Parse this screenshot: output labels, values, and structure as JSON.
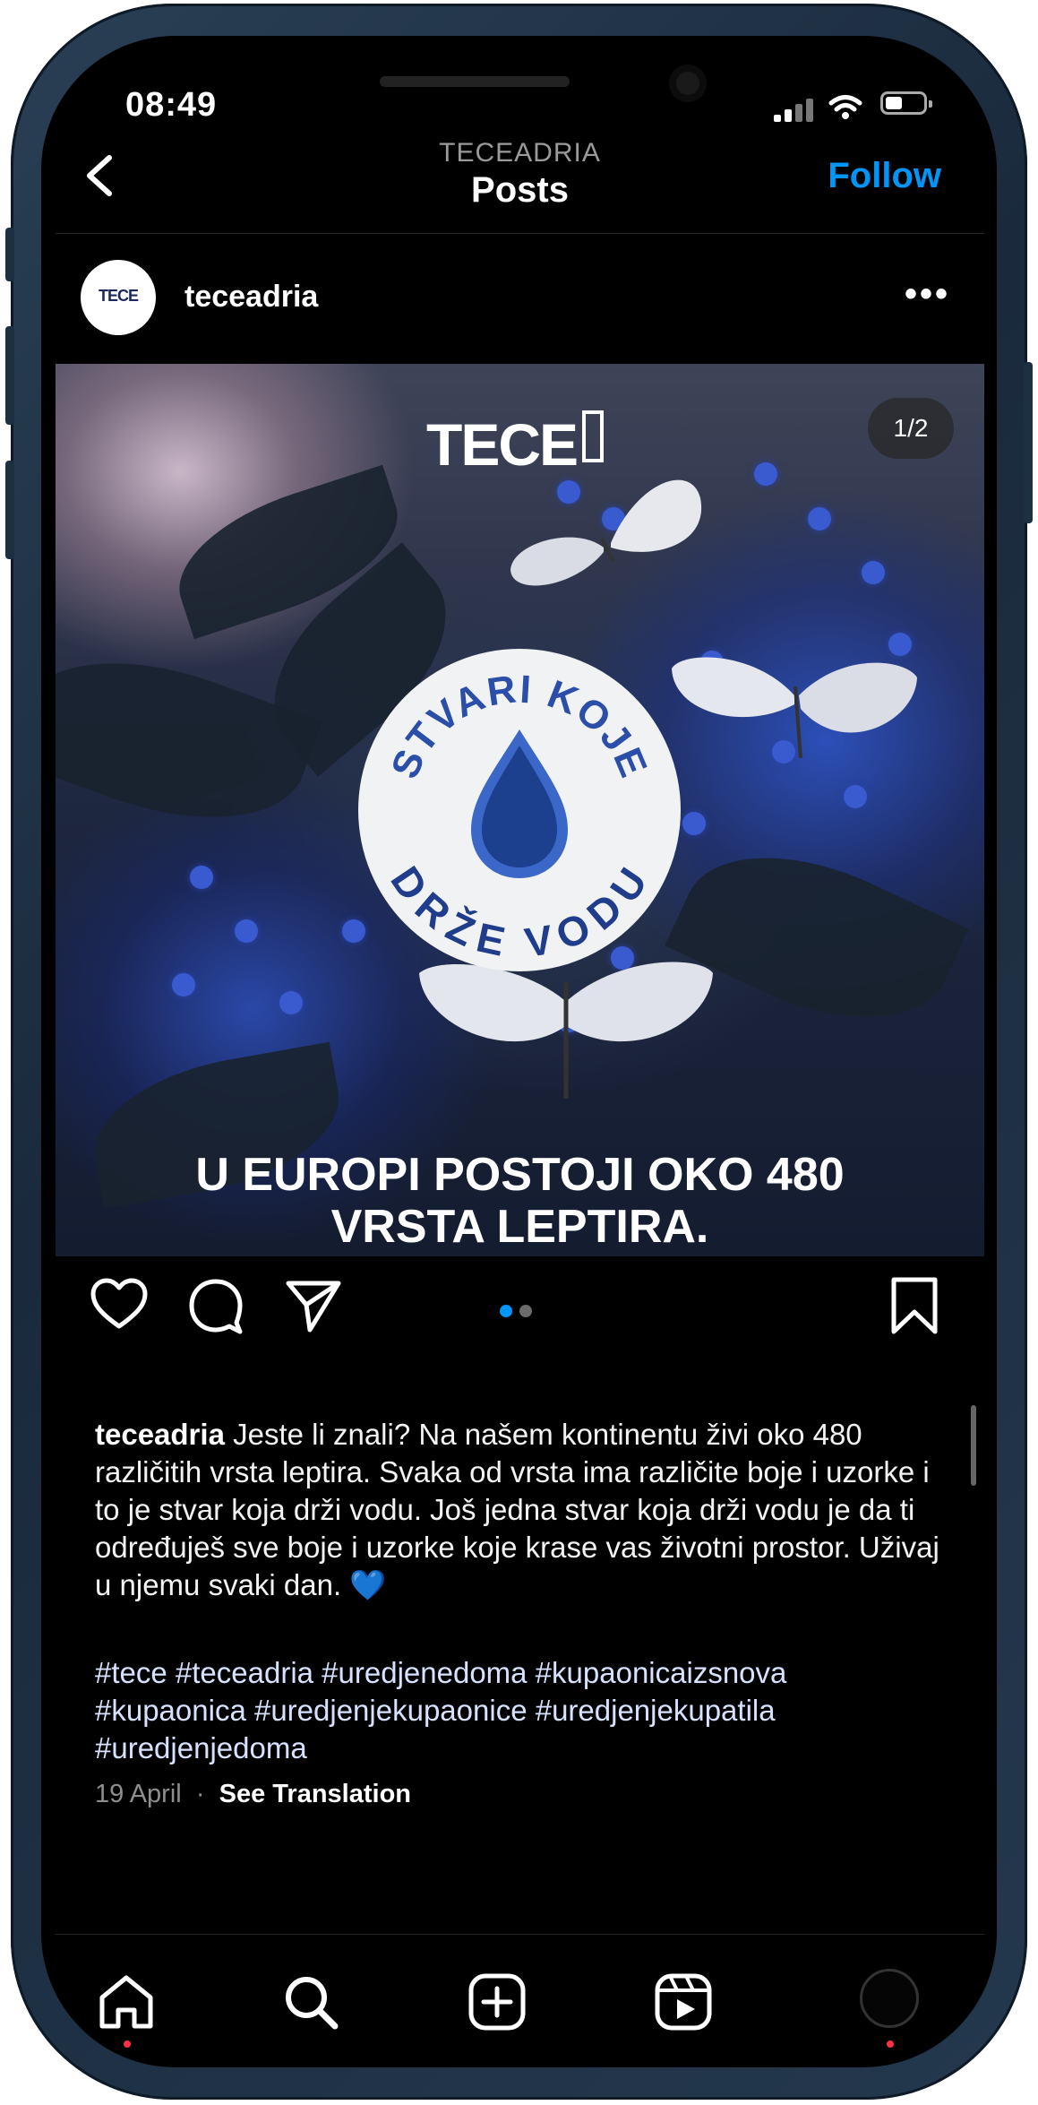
{
  "status_bar": {
    "time": "08:49"
  },
  "header": {
    "subtitle": "TECEADRIA",
    "title": "Posts",
    "follow_label": "Follow"
  },
  "post": {
    "avatar_text": "TECE",
    "username": "teceadria",
    "image": {
      "logo_text": "TECE",
      "counter": "1/2",
      "badge_top": "STVARI KOJE",
      "badge_bottom": "DRŽE VODU",
      "headline_line1": "U EUROPI POSTOJI OKO 480",
      "headline_line2": "VRSTA LEPTIRA."
    },
    "carousel": {
      "total": 2,
      "active_index": 1
    },
    "caption_username": "teceadria",
    "caption_text": " Jeste li znali? Na našem kontinentu živi oko 480 različitih vrsta leptira. Svaka od vrsta ima različite boje i uzorke i to je stvar koja drži vodu. Još jedna stvar koja drži vodu je da ti određuješ sve boje i uzorke koje krase vas životni prostor. Uživaj u njemu svaki dan. 💙",
    "hashtags": "#tece #teceadria #uredjenedoma #kupaonicaizsnova #kupaonica #uredjenjekupaonice #uredjenjekupatila #uredjenjedoma",
    "date": "19 April",
    "translation_label": "See Translation"
  },
  "colors": {
    "accent": "#0095f6",
    "background": "#000000",
    "notification": "#ff3040"
  },
  "icons": {
    "action_bar": [
      "heart-icon",
      "comment-icon",
      "share-icon",
      "bookmark-icon"
    ],
    "tab_bar": [
      "home-icon",
      "search-icon",
      "create-icon",
      "reels-icon",
      "profile-icon"
    ]
  }
}
